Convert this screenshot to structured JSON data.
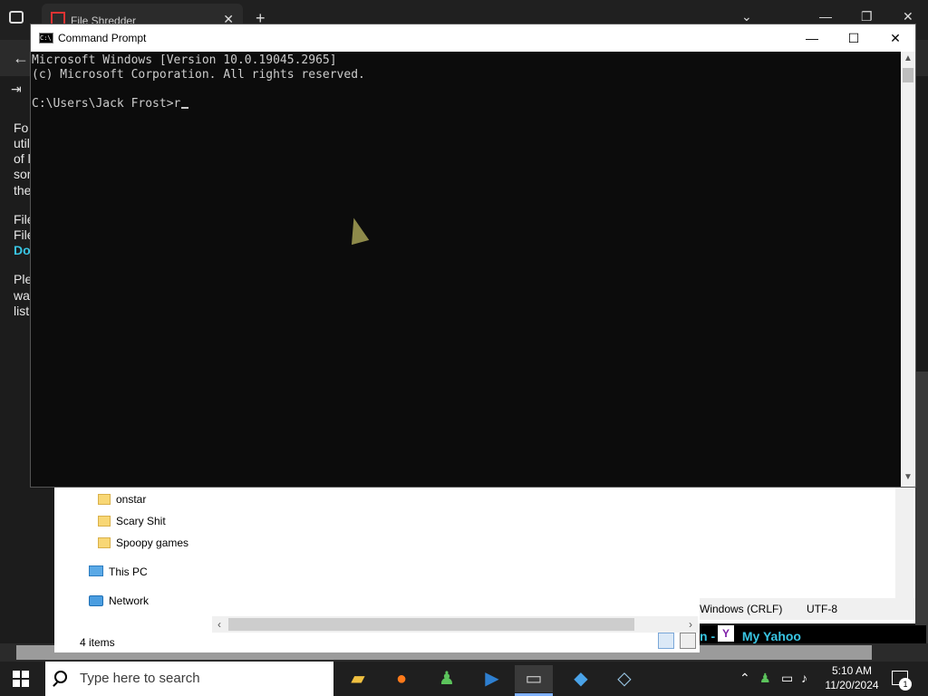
{
  "browser": {
    "tab_title": "File Shredder",
    "page_fragments": [
      "Fo",
      "util",
      "of l",
      "son",
      "the",
      "File",
      "File",
      "Ple",
      "wa",
      "list"
    ],
    "page_link": "Do"
  },
  "cmd": {
    "title": "Command Prompt",
    "lines": [
      "Microsoft Windows [Version 10.0.19045.2965]",
      "(c) Microsoft Corporation. All rights reserved.",
      "",
      "C:\\Users\\Jack Frost>r"
    ]
  },
  "explorer": {
    "nav_items": [
      "onstar",
      "Scary Shit",
      "Spoopy games"
    ],
    "this_pc": "This PC",
    "network": "Network",
    "item_count": "4 items"
  },
  "editor": {
    "status_line_ending": "Windows (CRLF)",
    "status_encoding": "UTF-8"
  },
  "yahoo": {
    "text": "n - ",
    "link": "My Yahoo"
  },
  "taskbar": {
    "search_placeholder": "Type here to search",
    "time": "5:10 AM",
    "date": "11/20/2024",
    "notification_count": "1"
  },
  "icons": [
    "tabs-menu-icon",
    "file-shredder-favicon",
    "close-icon",
    "new-tab-icon",
    "chevron-down-icon",
    "minimize-icon",
    "restore-icon",
    "back-arrow-icon",
    "login-icon",
    "cmd-icon",
    "maximize-icon",
    "folder-icon",
    "this-pc-icon",
    "network-icon",
    "details-view-icon",
    "large-icons-view-icon",
    "windows-start-icon",
    "search-icon",
    "file-explorer-icon",
    "firefox-icon",
    "people-icon",
    "powershell-icon",
    "command-prompt-icon",
    "recycle-bin-icon",
    "notepad-icon",
    "chevron-up-icon",
    "network-status-icon",
    "speaker-icon",
    "notification-icon",
    "yahoo-icon"
  ]
}
